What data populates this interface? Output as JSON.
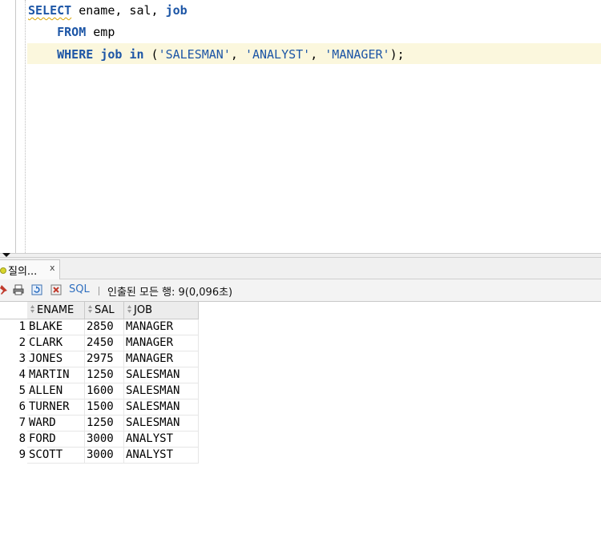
{
  "editor": {
    "lines": [
      {
        "tokens": [
          {
            "t": "SELECT",
            "c": "kw squig"
          },
          {
            "t": " ename, sal, ",
            "c": ""
          },
          {
            "t": "job",
            "c": "kw"
          }
        ]
      },
      {
        "tokens": [
          {
            "t": "    ",
            "c": ""
          },
          {
            "t": "FROM",
            "c": "kw"
          },
          {
            "t": " emp",
            "c": ""
          }
        ]
      },
      {
        "tokens": [
          {
            "t": "    ",
            "c": ""
          },
          {
            "t": "WHERE",
            "c": "kw"
          },
          {
            "t": " ",
            "c": ""
          },
          {
            "t": "job",
            "c": "kw"
          },
          {
            "t": " ",
            "c": ""
          },
          {
            "t": "in",
            "c": "kw"
          },
          {
            "t": " (",
            "c": ""
          },
          {
            "t": "'SALESMAN'",
            "c": "str"
          },
          {
            "t": ", ",
            "c": ""
          },
          {
            "t": "'ANALYST'",
            "c": "str"
          },
          {
            "t": ", ",
            "c": ""
          },
          {
            "t": "'MANAGER'",
            "c": "str"
          },
          {
            "t": ");",
            "c": ""
          }
        ]
      }
    ]
  },
  "result_tab": {
    "label": "질의...",
    "close": "x"
  },
  "toolbar": {
    "icons": [
      "pin-icon",
      "print-icon",
      "refresh-icon",
      "cancel-icon"
    ],
    "sql_label": "SQL",
    "status": "인출된 모든 행: 9(0,096초)"
  },
  "grid": {
    "columns": [
      "ENAME",
      "SAL",
      "JOB"
    ],
    "rows": [
      {
        "n": "1",
        "ename": "BLAKE",
        "sal": "2850",
        "job": "MANAGER"
      },
      {
        "n": "2",
        "ename": "CLARK",
        "sal": "2450",
        "job": "MANAGER"
      },
      {
        "n": "3",
        "ename": "JONES",
        "sal": "2975",
        "job": "MANAGER"
      },
      {
        "n": "4",
        "ename": "MARTIN",
        "sal": "1250",
        "job": "SALESMAN"
      },
      {
        "n": "5",
        "ename": "ALLEN",
        "sal": "1600",
        "job": "SALESMAN"
      },
      {
        "n": "6",
        "ename": "TURNER",
        "sal": "1500",
        "job": "SALESMAN"
      },
      {
        "n": "7",
        "ename": "WARD",
        "sal": "1250",
        "job": "SALESMAN"
      },
      {
        "n": "8",
        "ename": "FORD",
        "sal": "3000",
        "job": "ANALYST"
      },
      {
        "n": "9",
        "ename": "SCOTT",
        "sal": "3000",
        "job": "ANALYST"
      }
    ]
  }
}
